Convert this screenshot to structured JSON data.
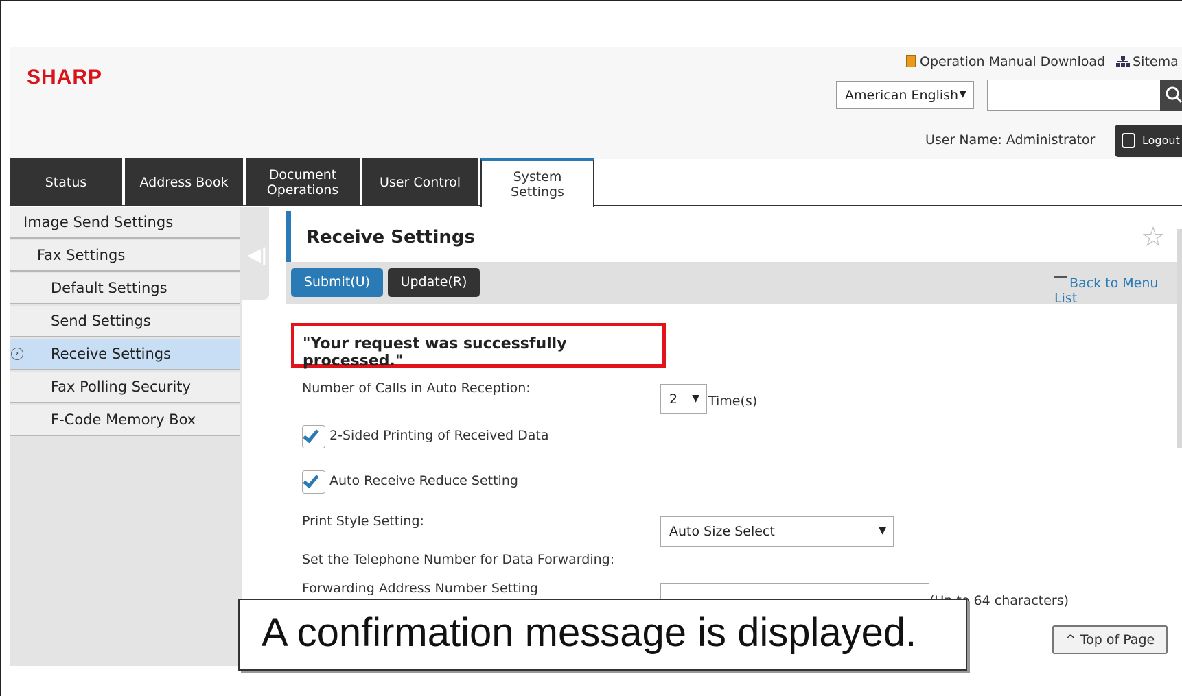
{
  "header": {
    "logo": "SHARP",
    "manual_link": "Operation Manual Download",
    "sitemap_link": "Sitema",
    "language": "American English",
    "search_value": "",
    "user_name_label": "User Name: Administrator",
    "logout_label": "Logout"
  },
  "tabs": [
    {
      "label": "Status",
      "active": false
    },
    {
      "label": "Address Book",
      "active": false
    },
    {
      "label": "Document\nOperations",
      "active": false
    },
    {
      "label": "User Control",
      "active": false
    },
    {
      "label": "System\nSettings",
      "active": true
    }
  ],
  "sidebar": {
    "items": [
      {
        "label": "Image Send Settings",
        "level": 0,
        "active": false
      },
      {
        "label": "Fax Settings",
        "level": 1,
        "active": false
      },
      {
        "label": "Default Settings",
        "level": 2,
        "active": false
      },
      {
        "label": "Send Settings",
        "level": 2,
        "active": false
      },
      {
        "label": "Receive Settings",
        "level": 2,
        "active": true
      },
      {
        "label": "Fax Polling Security",
        "level": 2,
        "active": false
      },
      {
        "label": "F-Code Memory Box",
        "level": 2,
        "active": false
      }
    ]
  },
  "main": {
    "title": "Receive Settings",
    "submit_label": "Submit(U)",
    "update_label": "Update(R)",
    "back_link": "Back to Menu List",
    "success_message": "\"Your request was successfully processed.\"",
    "calls_label": "Number of Calls in Auto Reception:",
    "calls_value": "2",
    "calls_unit": "Time(s)",
    "duplex_label": "2-Sided Printing of Received Data",
    "duplex_checked": true,
    "reduce_label": "Auto Receive Reduce Setting",
    "reduce_checked": true,
    "print_style_label": "Print Style Setting:",
    "print_style_value": "Auto Size Select",
    "forward_heading": "Set the Telephone Number for Data Forwarding:",
    "forward_label": "Forwarding Address Number Setting",
    "forward_value": "",
    "forward_hint": "(Up to 64 characters)",
    "top_of_page": "Top of Page"
  },
  "callout": {
    "text": "A confirmation message is displayed."
  },
  "colors": {
    "brand_red": "#d7141a",
    "accent_blue": "#2a7ab5",
    "tab_dark": "#333333",
    "highlight_red": "#e0141a",
    "active_row": "#c8def5"
  }
}
